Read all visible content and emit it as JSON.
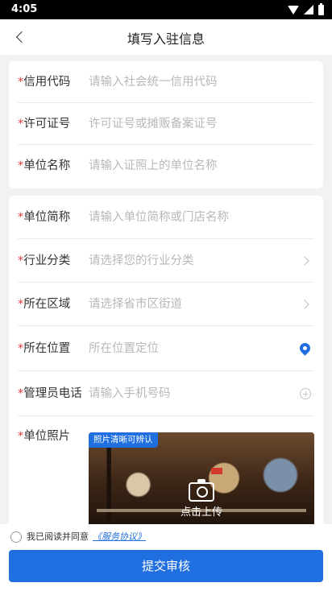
{
  "status_bar": {
    "time": "4:05"
  },
  "nav": {
    "title": "填写入驻信息"
  },
  "required_mark": "*",
  "form_basic": [
    {
      "label": "信用代码",
      "placeholder": "请输入社会统一信用代码"
    },
    {
      "label": "许可证号",
      "placeholder": "许可证号或摊贩备案证号"
    },
    {
      "label": "单位名称",
      "placeholder": "请输入证照上的单位名称"
    }
  ],
  "form_detail": [
    {
      "label": "单位简称",
      "placeholder": "请输入单位简称或门店名称",
      "accessory": "none"
    },
    {
      "label": "行业分类",
      "placeholder": "请选择您的行业分类",
      "accessory": "chevron-right-icon"
    },
    {
      "label": "所在区域",
      "placeholder": "请选择省市区街道",
      "accessory": "chevron-right-icon"
    },
    {
      "label": "所在位置",
      "placeholder": "所在位置定位",
      "accessory": "location-pin-icon"
    },
    {
      "label": "管理员电话",
      "placeholder": "请输入手机号码",
      "accessory": "plus-circle-icon"
    }
  ],
  "photo": {
    "label": "单位照片",
    "tag": "照片清晰可辨认",
    "upload_label": "点击上传"
  },
  "footer": {
    "agree_text": "我已阅读并同意",
    "agreement_link": "《服务协议》",
    "submit_label": "提交审核"
  },
  "colors": {
    "accent": "#1f6fe0",
    "required": "#e23a3a",
    "placeholder": "#b8b8b8"
  }
}
